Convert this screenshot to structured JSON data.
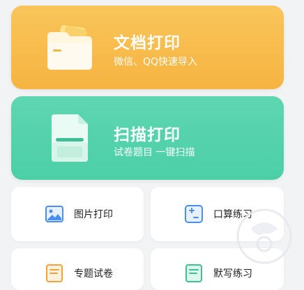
{
  "cards": [
    {
      "title": "文档打印",
      "subtitle": "微信、QQ快速导入",
      "icon": "folder-icon"
    },
    {
      "title": "扫描打印",
      "subtitle": "试卷题目  一键扫描",
      "icon": "scan-document-icon"
    }
  ],
  "tiles": [
    {
      "label": "图片打印",
      "icon": "image-icon"
    },
    {
      "label": "口算练习",
      "icon": "calculator-icon"
    },
    {
      "label": "专题试卷",
      "icon": "exam-paper-icon"
    },
    {
      "label": "默写练习",
      "icon": "dictation-icon"
    }
  ],
  "colors": {
    "doc_card": "#f6b441",
    "scan_card": "#4bcfa6",
    "tile_icon_blue": "#4a8ef0"
  }
}
